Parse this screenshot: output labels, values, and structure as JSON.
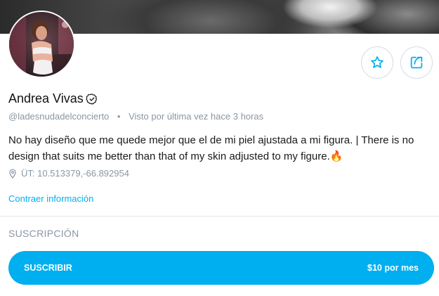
{
  "profile": {
    "name": "Andrea Vivas",
    "handle": "@ladesnudadelconcierto",
    "separator": "•",
    "last_seen": "Visto por última vez hace 3 horas",
    "bio": "No hay diseño que me quede mejor que el de mi piel ajustada a mi figura. | There is no design that suits me better than that of my skin adjusted to my figure.🔥",
    "location": "ÜT: 10.513379,-66.892954",
    "collapse_link": "Contraer información"
  },
  "actions": {
    "favorite_icon": "star-icon",
    "share_icon": "share-icon"
  },
  "subscription": {
    "section_title": "SUSCRIPCIÓN",
    "button_label": "SUSCRIBIR",
    "price": "$10 por mes"
  },
  "colors": {
    "accent": "#00aff0",
    "muted_text": "#8a96a3"
  }
}
